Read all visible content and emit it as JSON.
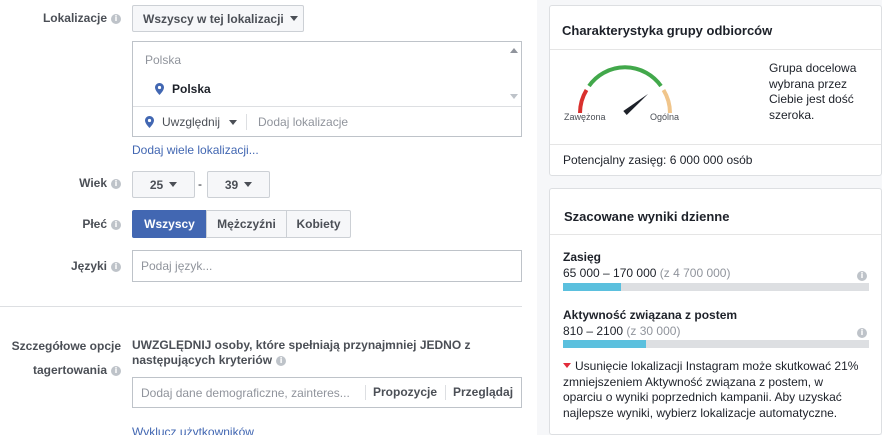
{
  "location": {
    "label": "Lokalizacje",
    "dropdown": "Wszyscy w tej lokalizacji",
    "group_header": "Polska",
    "selected_item": "Polska",
    "include_label": "Uwzględnij",
    "add_placeholder": "Dodaj lokalizacje",
    "add_many_link": "Dodaj wiele lokalizacji..."
  },
  "age": {
    "label": "Wiek",
    "from": "25",
    "dash": "-",
    "to": "39"
  },
  "gender": {
    "label": "Płeć",
    "options": [
      "Wszyscy",
      "Mężczyźni",
      "Kobiety"
    ],
    "selected": "Wszyscy"
  },
  "languages": {
    "label": "Języki",
    "placeholder": "Podaj język..."
  },
  "detailed": {
    "label_line1": "Szczegółowe opcje",
    "label_line2": "tagertowania",
    "description_line1": "UWZGLĘDNIJ osoby, które spełniają przynajmniej JEDNO z",
    "description_line2": "następujących kryteriów",
    "placeholder": "Dodaj dane demograficzne, zainteres...",
    "suggestions": "Propozycje",
    "browse": "Przeglądaj",
    "exclude_link": "Wyklucz użytkowników"
  },
  "audience_card": {
    "title": "Charakterystyka grupy odbiorców",
    "gauge_left": "Zawężona",
    "gauge_right": "Ogólna",
    "gauge_level": 0.78,
    "description": [
      "Grupa docelowa",
      "wybrana przez",
      "Ciebie jest dość",
      "szeroka."
    ],
    "potential_reach": "Potencjalny zasięg: 6 000 000 osób"
  },
  "daily_results": {
    "title": "Szacowane wyniki dzienne",
    "metrics": [
      {
        "name": "Zasięg",
        "range": "65 000 – 170 000",
        "total": "(z 4 700 000)",
        "fill": 0.19
      },
      {
        "name": "Aktywność związana z postem",
        "range": "810 – 2100",
        "total": "(z 30 000)",
        "fill": 0.27
      }
    ],
    "warning": [
      "Usunięcie lokalizacji Instagram może skutkować 21%",
      "zmniejszeniem Aktywność związana z postem, w",
      "oparciu o wyniki poprzednich kampanii. Aby uzyskać",
      "najlepsze wyniki, wybierz lokalizacje automatyczne."
    ]
  },
  "colors": {
    "accent": "#4267b2",
    "bar": "#5bc0de",
    "gauge_red": "#d9302d",
    "gauge_green": "#42a84b",
    "gauge_orange": "#f0c58b",
    "warning": "#e22b3a"
  }
}
